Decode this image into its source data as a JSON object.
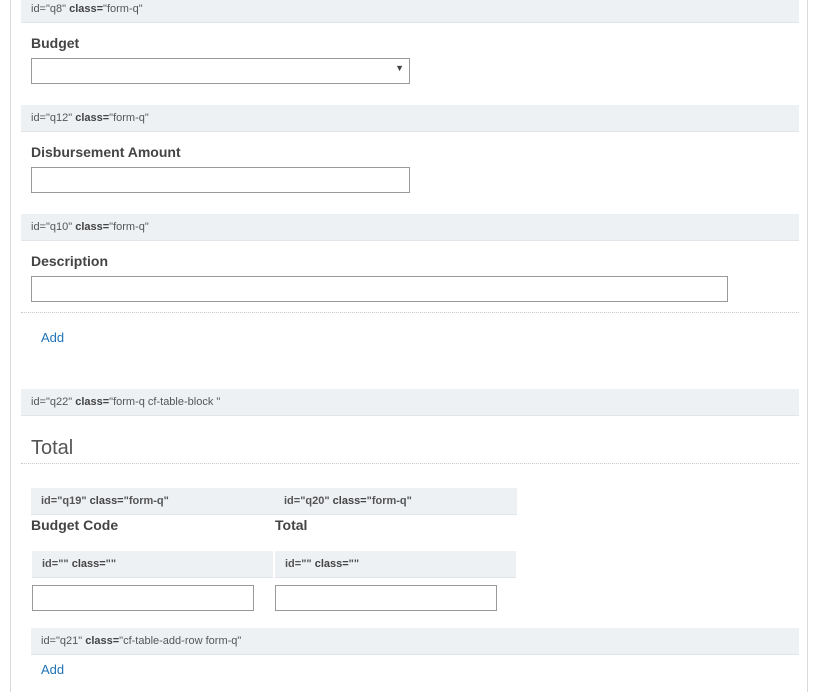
{
  "q8": {
    "id_label": "id=\"q8\"",
    "class_key": "class=",
    "class_val": "\"form-q\"",
    "label": "Budget",
    "select_value": "",
    "caret": "▼"
  },
  "q12": {
    "id_label": "id=\"q12\"",
    "class_key": "class=",
    "class_val": "\"form-q\"",
    "label": "Disbursement Amount",
    "value": ""
  },
  "q10": {
    "id_label": "id=\"q10\"",
    "class_key": "class=",
    "class_val": "\"form-q\"",
    "label": "Description",
    "value": ""
  },
  "add_link_1": "Add",
  "q22": {
    "id_label": "id=\"q22\"",
    "class_key": "class=",
    "class_val": "\"form-q cf-table-block \"",
    "title": "Total"
  },
  "table": {
    "q19": {
      "id_label": "id=\"q19\"",
      "class_key": "class=",
      "class_val": "\"form-q\"",
      "label": "Budget Code"
    },
    "q20": {
      "id_label": "id=\"q20\"",
      "class_key": "class=",
      "class_val": "\"form-q\"",
      "label": "Total"
    },
    "cell_a": {
      "id_label": "id=\"\"",
      "class_key": "class=",
      "class_val": "\"\"",
      "value": ""
    },
    "cell_b": {
      "id_label": "id=\"\"",
      "class_key": "class=",
      "class_val": "\"\"",
      "value": ""
    }
  },
  "q21": {
    "id_label": "id=\"q21\"",
    "class_key": "class=",
    "class_val": "\"cf-table-add-row form-q\"",
    "add_label": "Add"
  }
}
